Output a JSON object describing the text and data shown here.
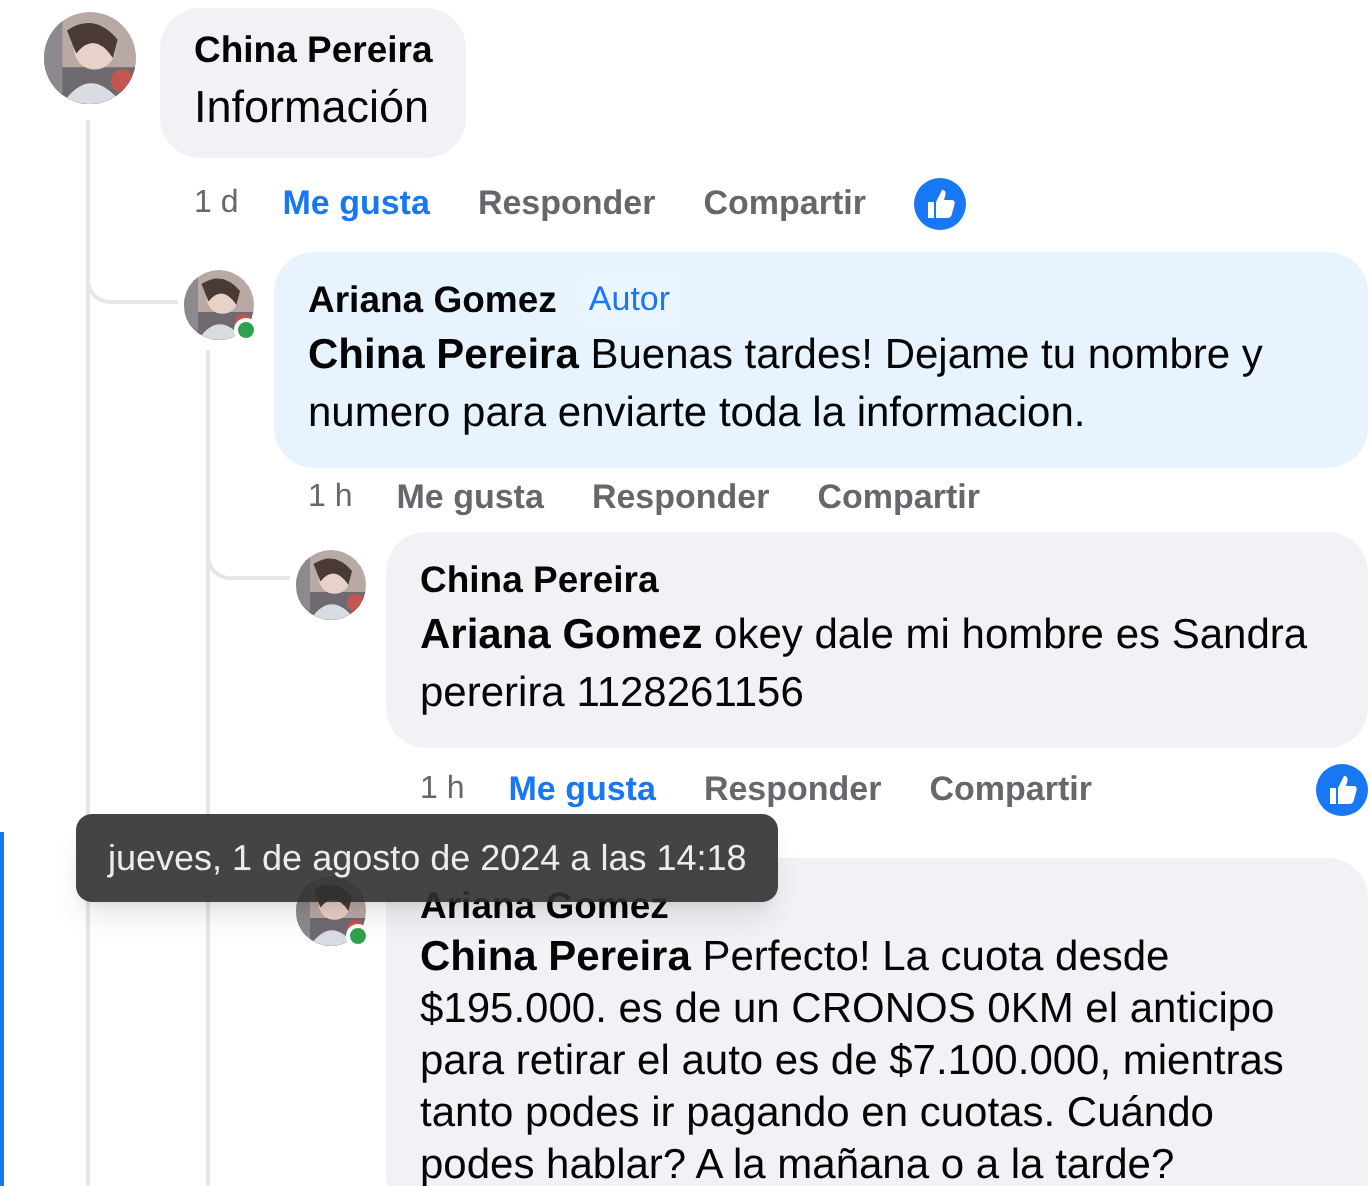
{
  "comments": [
    {
      "author": "China Pereira",
      "text": "Información",
      "time": "1 d",
      "actions": [
        {
          "label": "Me gusta",
          "selected": true
        },
        {
          "label": "Responder"
        },
        {
          "label": "Compartir"
        }
      ],
      "liked": true,
      "online": false,
      "children": [
        {
          "author": "Ariana Gomez",
          "badge": "Autor",
          "text": "**China Pereira** Buenas tardes! Dejame tu nombre y numero para enviarte toda la informacion.",
          "time": "1 h",
          "actions": [
            {
              "label": "Me gusta",
              "selected": false
            },
            {
              "label": "Responder"
            },
            {
              "label": "Compartir"
            }
          ],
          "liked": false,
          "online": true,
          "children": [
            {
              "author": "China Pereira",
              "text": "**Ariana Gomez** okey dale mi hombre es Sandra pererira 1128261156",
              "time": "1 h",
              "actions": [
                {
                  "label": "Me gusta",
                  "selected": true
                },
                {
                  "label": "Responder"
                },
                {
                  "label": "Compartir"
                }
              ],
              "liked": true,
              "online": false
            },
            {
              "author": "Ariana Gomez",
              "text": "**China Pereira** Perfecto! La cuota desde $195.000. es de un CRONOS 0KM el anticipo para retirar el auto es de $7.100.000, mientras tanto podes ir pagando en cuotas. Cuándo podes hablar? A la mañana o a la tarde?",
              "online": true
            }
          ]
        }
      ]
    }
  ],
  "tooltip": "jueves, 1 de agosto de 2024 a las 14:18"
}
